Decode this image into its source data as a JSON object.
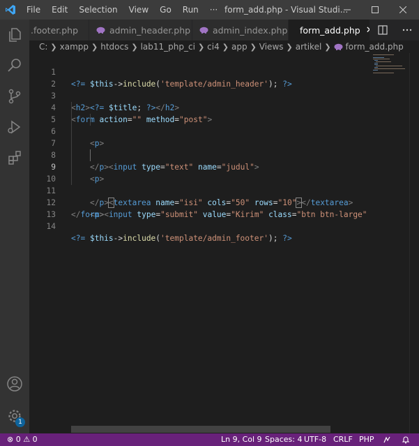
{
  "window": {
    "title": "form_add.php - Visual Studi...",
    "menu": [
      "File",
      "Edit",
      "Selection",
      "View",
      "Go",
      "Run",
      "···"
    ]
  },
  "tabs": [
    {
      "label": ".footer.php",
      "active": false,
      "icon": "php-elephant-icon"
    },
    {
      "label": "admin_header.php",
      "active": false,
      "icon": "php-elephant-icon"
    },
    {
      "label": "admin_index.php",
      "active": false,
      "icon": "php-elephant-icon"
    },
    {
      "label": "form_add.php",
      "active": true,
      "icon": "php-elephant-icon"
    }
  ],
  "breadcrumb": [
    "C:",
    "xampp",
    "htdocs",
    "lab11_php_ci",
    "ci4",
    "app",
    "Views",
    "artikel",
    "form_add.php"
  ],
  "code": {
    "line_numbers": [
      "1",
      "2",
      "3",
      "4",
      "5",
      "6",
      "7",
      "8",
      "9",
      "10",
      "11",
      "12",
      "13",
      "14"
    ],
    "active_line": 9
  },
  "status": {
    "errors": "0",
    "warnings": "0",
    "position": "Ln 9, Col 9",
    "spaces": "Spaces: 4",
    "encoding": "UTF-8",
    "eol": "CRLF",
    "language": "PHP"
  },
  "badges": {
    "settings": "1"
  },
  "colors": {
    "statusbar": "#68217a",
    "accent": "#0e639c",
    "php_icon": "#a074c4"
  }
}
